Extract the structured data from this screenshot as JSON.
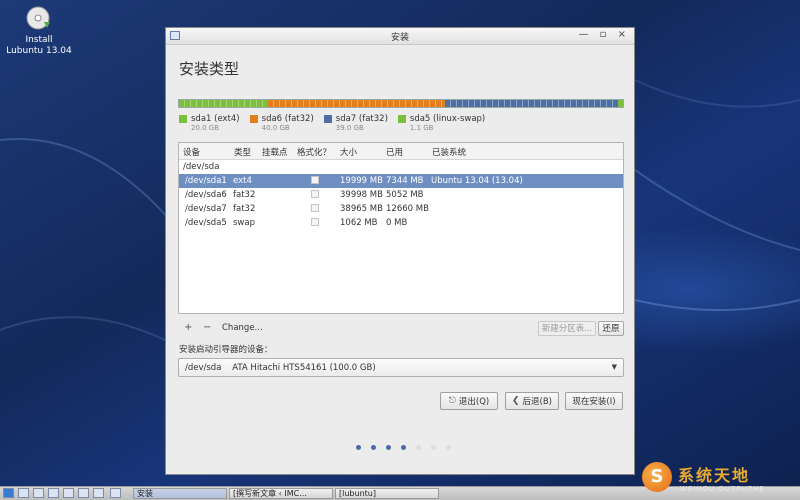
{
  "desktop": {
    "icon_label_1": "Install",
    "icon_label_2": "Lubuntu 13.04"
  },
  "window": {
    "title": "安装",
    "controls": "— ▫ ×",
    "heading": "安装类型"
  },
  "partition_bar": {
    "segments": [
      {
        "name": "sda1 (ext4)",
        "size": "20.0 GB",
        "color": "#7cbf3a",
        "size_mb": 19999
      },
      {
        "name": "sda6 (fat32)",
        "size": "40.0 GB",
        "color": "#e37f1c",
        "size_mb": 39998
      },
      {
        "name": "sda7 (fat32)",
        "size": "39.0 GB",
        "color": "#4e6fa3",
        "size_mb": 38965
      },
      {
        "name": "sda5 (linux-swap)",
        "size": "1.1 GB",
        "color": "#7cbf3a",
        "size_mb": 1062
      }
    ]
  },
  "table": {
    "headers": {
      "device": "设备",
      "type": "类型",
      "mount": "挂载点",
      "format": "格式化？",
      "size": "大小",
      "used": "已用",
      "system": "已装系统"
    },
    "group": "/dev/sda",
    "rows": [
      {
        "device": "/dev/sda1",
        "type": "ext4",
        "size": "19999 MB",
        "used": "7344 MB",
        "system": "Ubuntu 13.04 (13.04)"
      },
      {
        "device": "/dev/sda6",
        "type": "fat32",
        "size": "39998 MB",
        "used": "5052 MB",
        "system": ""
      },
      {
        "device": "/dev/sda7",
        "type": "fat32",
        "size": "38965 MB",
        "used": "12660 MB",
        "system": ""
      },
      {
        "device": "/dev/sda5",
        "type": "swap",
        "size": "1062 MB",
        "used": "0 MB",
        "system": ""
      }
    ],
    "selected_row": 0
  },
  "toolbar": {
    "add": "+",
    "remove": "−",
    "change": "Change...",
    "new_table": "新建分区表...",
    "revert": "还原"
  },
  "boot": {
    "label": "安装启动引导器的设备：",
    "selected": "/dev/sda    ATA Hitachi HTS54161 (100.0 GB)"
  },
  "buttons": {
    "quit": "退出(Q)",
    "back": "后退(B)",
    "install": "现在安装(I)"
  },
  "progress": {
    "steps_done": 4,
    "steps_total": 7
  },
  "taskbar": {
    "task_1": "安装",
    "task_2": "[撰写新文章 ‹ IMC...",
    "task_3": "[lubuntu]"
  },
  "watermark": {
    "logo_letter": "S",
    "text": "系统天地",
    "sub": "WEIHOU  OUTPUTHE"
  }
}
